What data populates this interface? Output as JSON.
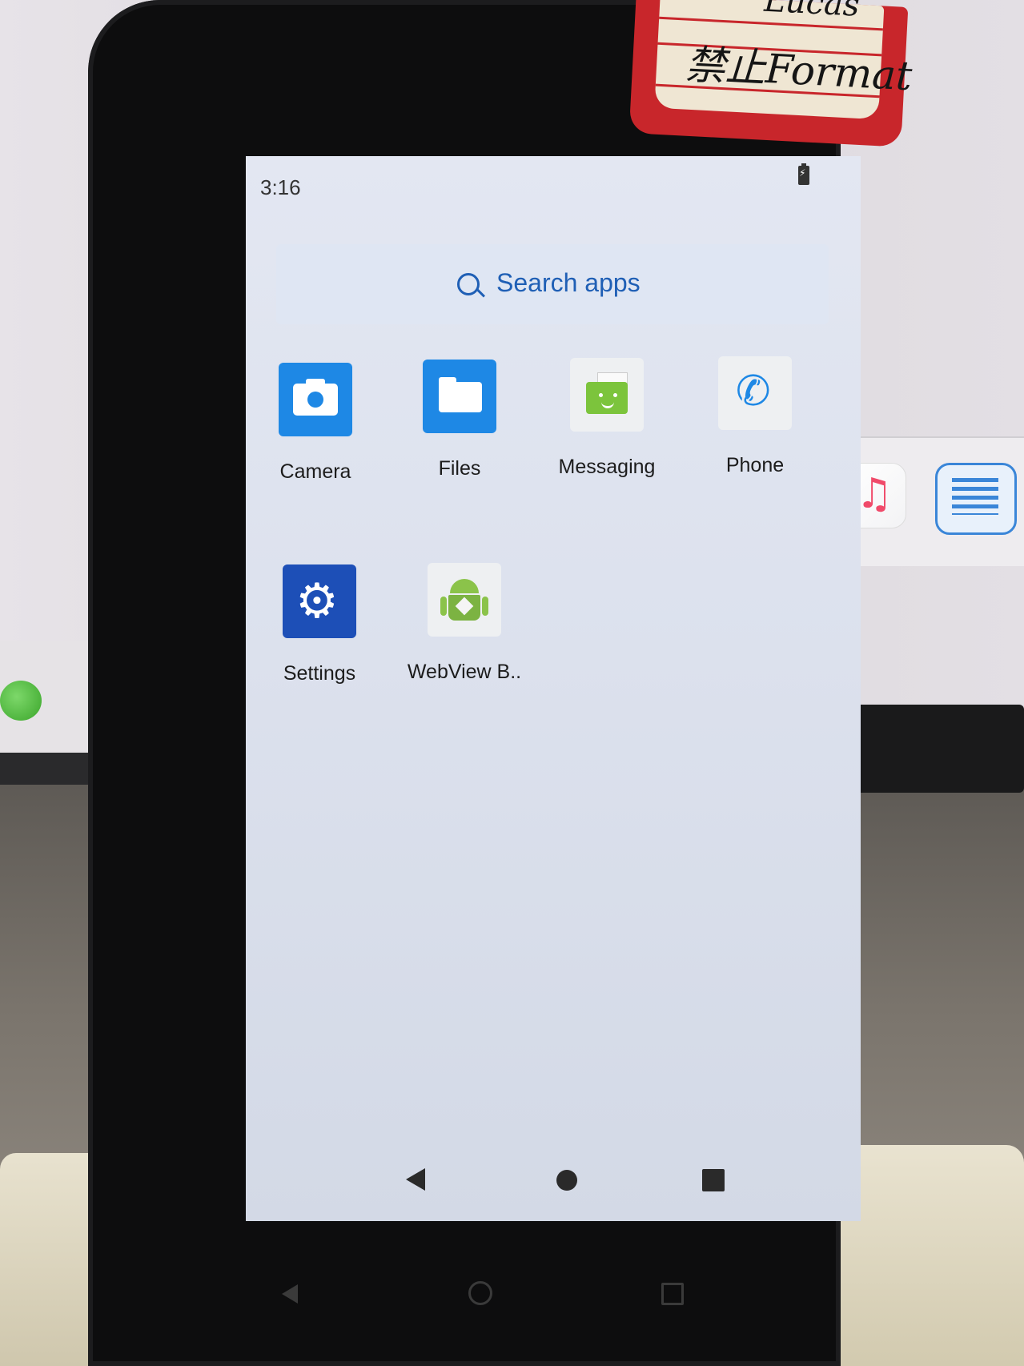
{
  "status_bar": {
    "time": "3:16",
    "battery_icon": "battery-charging-icon"
  },
  "search": {
    "placeholder": "Search apps",
    "icon": "search-icon"
  },
  "apps": [
    {
      "label": "Camera",
      "icon": "camera-icon"
    },
    {
      "label": "Files",
      "icon": "folder-icon"
    },
    {
      "label": "Messaging",
      "icon": "messaging-icon"
    },
    {
      "label": "Phone",
      "icon": "phone-icon"
    },
    {
      "label": "Settings",
      "icon": "gear-icon"
    },
    {
      "label": "WebView B..",
      "icon": "android-icon"
    }
  ],
  "nav_bar": {
    "back": "back-icon",
    "home": "home-icon",
    "recents": "recents-icon"
  },
  "sticker": {
    "line1": "Lucas",
    "line2": "禁止Format"
  },
  "colors": {
    "accent": "#1f5fb5",
    "app_blue": "#1e88e5",
    "settings_blue": "#1d4fb7",
    "android_green": "#8bc34a"
  }
}
